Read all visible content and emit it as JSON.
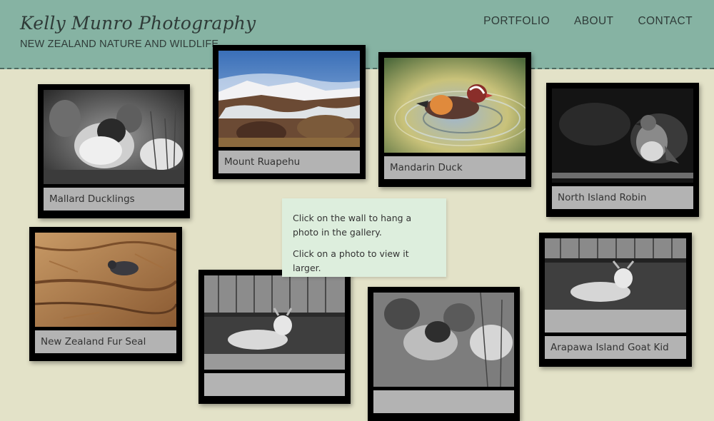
{
  "header": {
    "title": "Kelly Munro Photography",
    "subtitle": "NEW ZEALAND NATURE AND WILDLIFE",
    "nav": [
      "PORTFOLIO",
      "ABOUT",
      "CONTACT"
    ]
  },
  "photos": [
    {
      "caption": "Mallard Ducklings",
      "subject": "ducklings-bw"
    },
    {
      "caption": "Mount Ruapehu",
      "subject": "mountain"
    },
    {
      "caption": "Mandarin Duck",
      "subject": "mandarin-duck"
    },
    {
      "caption": "North Island Robin",
      "subject": "robin-bw"
    },
    {
      "caption": "New Zealand Fur Seal",
      "subject": "fur-seal"
    },
    {
      "caption": "",
      "subject": "goat-kid-bw"
    },
    {
      "caption": "",
      "subject": "ducklings-bw"
    },
    {
      "caption": "Arapawa Island Goat Kid",
      "subject": "goat-kid-bw"
    }
  ],
  "instructions": {
    "line1": "Click on the wall to hang a photo in the gallery.",
    "line2": "Click on a photo to view it larger."
  },
  "colors": {
    "header_bg": "#86b3a3",
    "wall_bg": "#e3e2c8",
    "frame": "#000000",
    "caption_bg": "#b3b3b3",
    "note_bg": "#ddeedd"
  }
}
